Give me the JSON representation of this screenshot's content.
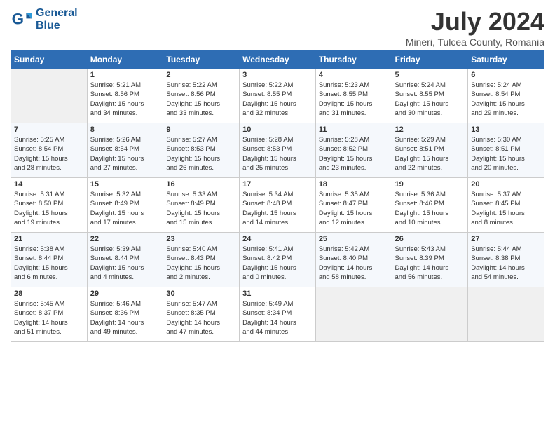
{
  "logo": {
    "line1": "General",
    "line2": "Blue"
  },
  "title": "July 2024",
  "location": "Mineri, Tulcea County, Romania",
  "weekdays": [
    "Sunday",
    "Monday",
    "Tuesday",
    "Wednesday",
    "Thursday",
    "Friday",
    "Saturday"
  ],
  "weeks": [
    [
      {
        "day": "",
        "info": ""
      },
      {
        "day": "1",
        "info": "Sunrise: 5:21 AM\nSunset: 8:56 PM\nDaylight: 15 hours\nand 34 minutes."
      },
      {
        "day": "2",
        "info": "Sunrise: 5:22 AM\nSunset: 8:56 PM\nDaylight: 15 hours\nand 33 minutes."
      },
      {
        "day": "3",
        "info": "Sunrise: 5:22 AM\nSunset: 8:55 PM\nDaylight: 15 hours\nand 32 minutes."
      },
      {
        "day": "4",
        "info": "Sunrise: 5:23 AM\nSunset: 8:55 PM\nDaylight: 15 hours\nand 31 minutes."
      },
      {
        "day": "5",
        "info": "Sunrise: 5:24 AM\nSunset: 8:55 PM\nDaylight: 15 hours\nand 30 minutes."
      },
      {
        "day": "6",
        "info": "Sunrise: 5:24 AM\nSunset: 8:54 PM\nDaylight: 15 hours\nand 29 minutes."
      }
    ],
    [
      {
        "day": "7",
        "info": "Sunrise: 5:25 AM\nSunset: 8:54 PM\nDaylight: 15 hours\nand 28 minutes."
      },
      {
        "day": "8",
        "info": "Sunrise: 5:26 AM\nSunset: 8:54 PM\nDaylight: 15 hours\nand 27 minutes."
      },
      {
        "day": "9",
        "info": "Sunrise: 5:27 AM\nSunset: 8:53 PM\nDaylight: 15 hours\nand 26 minutes."
      },
      {
        "day": "10",
        "info": "Sunrise: 5:28 AM\nSunset: 8:53 PM\nDaylight: 15 hours\nand 25 minutes."
      },
      {
        "day": "11",
        "info": "Sunrise: 5:28 AM\nSunset: 8:52 PM\nDaylight: 15 hours\nand 23 minutes."
      },
      {
        "day": "12",
        "info": "Sunrise: 5:29 AM\nSunset: 8:51 PM\nDaylight: 15 hours\nand 22 minutes."
      },
      {
        "day": "13",
        "info": "Sunrise: 5:30 AM\nSunset: 8:51 PM\nDaylight: 15 hours\nand 20 minutes."
      }
    ],
    [
      {
        "day": "14",
        "info": "Sunrise: 5:31 AM\nSunset: 8:50 PM\nDaylight: 15 hours\nand 19 minutes."
      },
      {
        "day": "15",
        "info": "Sunrise: 5:32 AM\nSunset: 8:49 PM\nDaylight: 15 hours\nand 17 minutes."
      },
      {
        "day": "16",
        "info": "Sunrise: 5:33 AM\nSunset: 8:49 PM\nDaylight: 15 hours\nand 15 minutes."
      },
      {
        "day": "17",
        "info": "Sunrise: 5:34 AM\nSunset: 8:48 PM\nDaylight: 15 hours\nand 14 minutes."
      },
      {
        "day": "18",
        "info": "Sunrise: 5:35 AM\nSunset: 8:47 PM\nDaylight: 15 hours\nand 12 minutes."
      },
      {
        "day": "19",
        "info": "Sunrise: 5:36 AM\nSunset: 8:46 PM\nDaylight: 15 hours\nand 10 minutes."
      },
      {
        "day": "20",
        "info": "Sunrise: 5:37 AM\nSunset: 8:45 PM\nDaylight: 15 hours\nand 8 minutes."
      }
    ],
    [
      {
        "day": "21",
        "info": "Sunrise: 5:38 AM\nSunset: 8:44 PM\nDaylight: 15 hours\nand 6 minutes."
      },
      {
        "day": "22",
        "info": "Sunrise: 5:39 AM\nSunset: 8:44 PM\nDaylight: 15 hours\nand 4 minutes."
      },
      {
        "day": "23",
        "info": "Sunrise: 5:40 AM\nSunset: 8:43 PM\nDaylight: 15 hours\nand 2 minutes."
      },
      {
        "day": "24",
        "info": "Sunrise: 5:41 AM\nSunset: 8:42 PM\nDaylight: 15 hours\nand 0 minutes."
      },
      {
        "day": "25",
        "info": "Sunrise: 5:42 AM\nSunset: 8:40 PM\nDaylight: 14 hours\nand 58 minutes."
      },
      {
        "day": "26",
        "info": "Sunrise: 5:43 AM\nSunset: 8:39 PM\nDaylight: 14 hours\nand 56 minutes."
      },
      {
        "day": "27",
        "info": "Sunrise: 5:44 AM\nSunset: 8:38 PM\nDaylight: 14 hours\nand 54 minutes."
      }
    ],
    [
      {
        "day": "28",
        "info": "Sunrise: 5:45 AM\nSunset: 8:37 PM\nDaylight: 14 hours\nand 51 minutes."
      },
      {
        "day": "29",
        "info": "Sunrise: 5:46 AM\nSunset: 8:36 PM\nDaylight: 14 hours\nand 49 minutes."
      },
      {
        "day": "30",
        "info": "Sunrise: 5:47 AM\nSunset: 8:35 PM\nDaylight: 14 hours\nand 47 minutes."
      },
      {
        "day": "31",
        "info": "Sunrise: 5:49 AM\nSunset: 8:34 PM\nDaylight: 14 hours\nand 44 minutes."
      },
      {
        "day": "",
        "info": ""
      },
      {
        "day": "",
        "info": ""
      },
      {
        "day": "",
        "info": ""
      }
    ]
  ]
}
